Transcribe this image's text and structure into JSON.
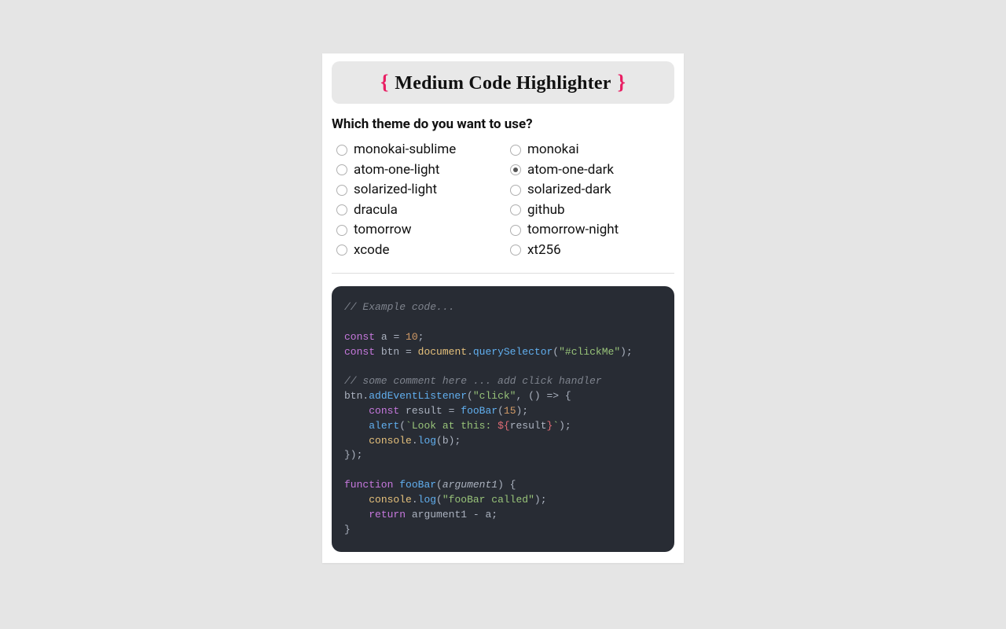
{
  "title": "Medium Code Highlighter",
  "question": "Which theme do you want to use?",
  "selected_theme": "atom-one-dark",
  "themes_col1": [
    "monokai-sublime",
    "atom-one-light",
    "solarized-light",
    "dracula",
    "tomorrow",
    "xcode"
  ],
  "themes_col2": [
    "monokai",
    "atom-one-dark",
    "solarized-dark",
    "github",
    "tomorrow-night",
    "xt256"
  ],
  "code": {
    "c_example": "// Example code...",
    "c_some": "// some comment here ... add click handler",
    "kw_const": "const",
    "kw_function": "function",
    "kw_return": "return",
    "v_a": "a",
    "v_btn": "btn",
    "v_result": "result",
    "v_arg1": "argument1",
    "v_b": "b",
    "n_10": "10",
    "n_15": "15",
    "s_clickme": "\"#clickMe\"",
    "s_click": "\"click\"",
    "s_foobar": "\"fooBar called\"",
    "s_look_pre": "`Look at this: ",
    "s_look_suf": "`",
    "subst_open": "${",
    "subst_close": "}",
    "bi_document": "document",
    "bi_console": "console",
    "fn_qs": "querySelector",
    "fn_ael": "addEventListener",
    "fn_foobar": "fooBar",
    "fn_alert": "alert",
    "fn_log": "log"
  }
}
